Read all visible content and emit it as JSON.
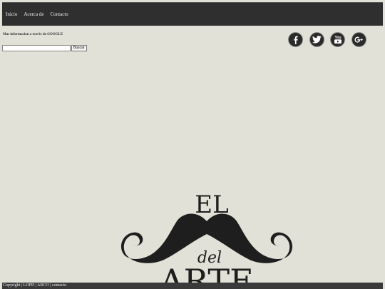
{
  "nav": {
    "items": [
      {
        "label": "Inicio"
      },
      {
        "label": "Acerca de"
      },
      {
        "label": "Contacto"
      }
    ]
  },
  "search": {
    "label": "Mas informacion a travès de GOOGLE",
    "button_label": "Buscar"
  },
  "social": [
    {
      "icon": "facebook-icon"
    },
    {
      "icon": "twitter-icon"
    },
    {
      "icon": "youtube-icon",
      "text": "You"
    },
    {
      "icon": "google-plus-icon"
    }
  ],
  "logo": {
    "line1": "EL",
    "line2": "del",
    "line3": "ARTE"
  },
  "footer": {
    "copyright": "Copyright",
    "sep": " | ",
    "lopd": "LOPD",
    "arco": "ARCO",
    "contacto": "contacto"
  },
  "colors": {
    "background": "#e1e1d7",
    "topbar": "#2f2f2f",
    "footer": "#3a3a3a",
    "logo": "#1e1e1e"
  }
}
